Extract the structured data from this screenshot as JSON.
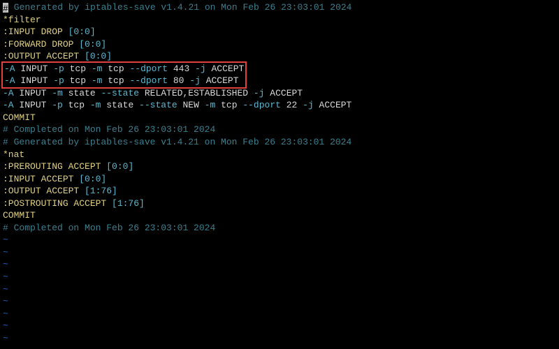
{
  "gen_comment1_a": "#",
  "gen_comment1_b": " Generated by iptables-save v1.4.21 on Mon Feb 26 23:03:01 2024",
  "filter_table": "*filter",
  "input_drop_a": ":INPUT DROP ",
  "input_drop_b": "[0:0]",
  "forward_drop_a": ":FORWARD DROP ",
  "forward_drop_b": "[0:0]",
  "output_accept_a": ":OUTPUT ACCEPT ",
  "output_accept_b": "[0:0]",
  "hl1_a": "-A",
  "hl1_b": " INPUT ",
  "hl1_c": "-p",
  "hl1_d": " tcp ",
  "hl1_e": "-m",
  "hl1_f": " tcp ",
  "hl1_g": "--dport",
  "hl1_h": " 443 ",
  "hl1_i": "-j",
  "hl1_j": " ACCEPT",
  "hl2_a": "-A",
  "hl2_b": " INPUT ",
  "hl2_c": "-p",
  "hl2_d": " tcp ",
  "hl2_e": "-m",
  "hl2_f": " tcp ",
  "hl2_g": "--dport",
  "hl2_h": " 80 ",
  "hl2_i": "-j",
  "hl2_j": " ACCEPT",
  "r3_a": "-A",
  "r3_b": " INPUT ",
  "r3_c": "-m",
  "r3_d": " state ",
  "r3_e": "--state",
  "r3_f": " RELATED,ESTABLISHED ",
  "r3_g": "-j",
  "r3_h": " ACCEPT",
  "r4_a": "-A",
  "r4_b": " INPUT ",
  "r4_c": "-p",
  "r4_d": " tcp ",
  "r4_e": "-m",
  "r4_f": " state ",
  "r4_g": "--state",
  "r4_h": " NEW ",
  "r4_i": "-m",
  "r4_j": " tcp ",
  "r4_k": "--dport",
  "r4_l": " 22 ",
  "r4_m": "-j",
  "r4_n": " ACCEPT",
  "commit1": "COMMIT",
  "completed1": "# Completed on Mon Feb 26 23:03:01 2024",
  "gen_comment2": "# Generated by iptables-save v1.4.21 on Mon Feb 26 23:03:01 2024",
  "nat_table": "*nat",
  "prerouting_a": ":PREROUTING ACCEPT ",
  "prerouting_b": "[0:0]",
  "nat_input_a": ":INPUT ACCEPT ",
  "nat_input_b": "[0:0]",
  "nat_output_a": ":OUTPUT ACCEPT ",
  "nat_output_b": "[1:76]",
  "postrouting_a": ":POSTROUTING ACCEPT ",
  "postrouting_b": "[1:76]",
  "commit2": "COMMIT",
  "completed2": "# Completed on Mon Feb 26 23:03:01 2024",
  "tilde": "~"
}
